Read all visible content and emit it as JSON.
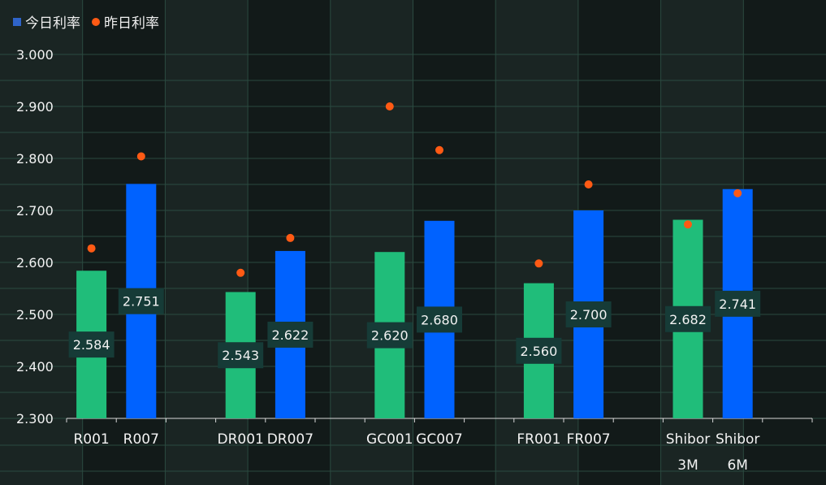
{
  "legend": {
    "today_label": "今日利率",
    "yesterday_label": "昨日利率"
  },
  "colors": {
    "background": "#121a19",
    "band_alt": "#1a2523",
    "grid": "#2b4a40",
    "bar_1d": "#20bd7a",
    "bar_7d": "#0062ff",
    "dot": "#ff5a14",
    "label_bg": "#163b37"
  },
  "chart_data": {
    "type": "bar",
    "title": "",
    "xlabel": "",
    "ylabel": "",
    "ylim": [
      2.3,
      3.0
    ],
    "y_ticks": [
      "3.000",
      "2.900",
      "2.800",
      "2.700",
      "2.600",
      "2.500",
      "2.400",
      "2.300"
    ],
    "grid": true,
    "legend_position": "top-left",
    "groups": [
      {
        "bars": [
          {
            "label": "R001",
            "today": 2.584,
            "yesterday": 2.627,
            "display": "2.584",
            "kind": "1d"
          },
          {
            "label": "R007",
            "today": 2.751,
            "yesterday": 2.804,
            "display": "2.751",
            "kind": "7d"
          }
        ]
      },
      {
        "bars": [
          {
            "label": "DR001",
            "today": 2.543,
            "yesterday": 2.58,
            "display": "2.543",
            "kind": "1d"
          },
          {
            "label": "DR007",
            "today": 2.622,
            "yesterday": 2.647,
            "display": "2.622",
            "kind": "7d"
          }
        ]
      },
      {
        "bars": [
          {
            "label": "GC001",
            "today": 2.62,
            "yesterday": 2.9,
            "display": "2.620",
            "kind": "1d"
          },
          {
            "label": "GC007",
            "today": 2.68,
            "yesterday": 2.816,
            "display": "2.680",
            "kind": "7d"
          }
        ]
      },
      {
        "bars": [
          {
            "label": "FR001",
            "today": 2.56,
            "yesterday": 2.598,
            "display": "2.560",
            "kind": "1d"
          },
          {
            "label": "FR007",
            "today": 2.7,
            "yesterday": 2.75,
            "display": "2.700",
            "kind": "7d"
          }
        ]
      },
      {
        "bars": [
          {
            "label": "Shibor\n3M",
            "today": 2.682,
            "yesterday": 2.673,
            "display": "2.682",
            "kind": "1d"
          },
          {
            "label": "Shibor\n6M",
            "today": 2.741,
            "yesterday": 2.733,
            "display": "2.741",
            "kind": "7d"
          }
        ]
      }
    ]
  }
}
